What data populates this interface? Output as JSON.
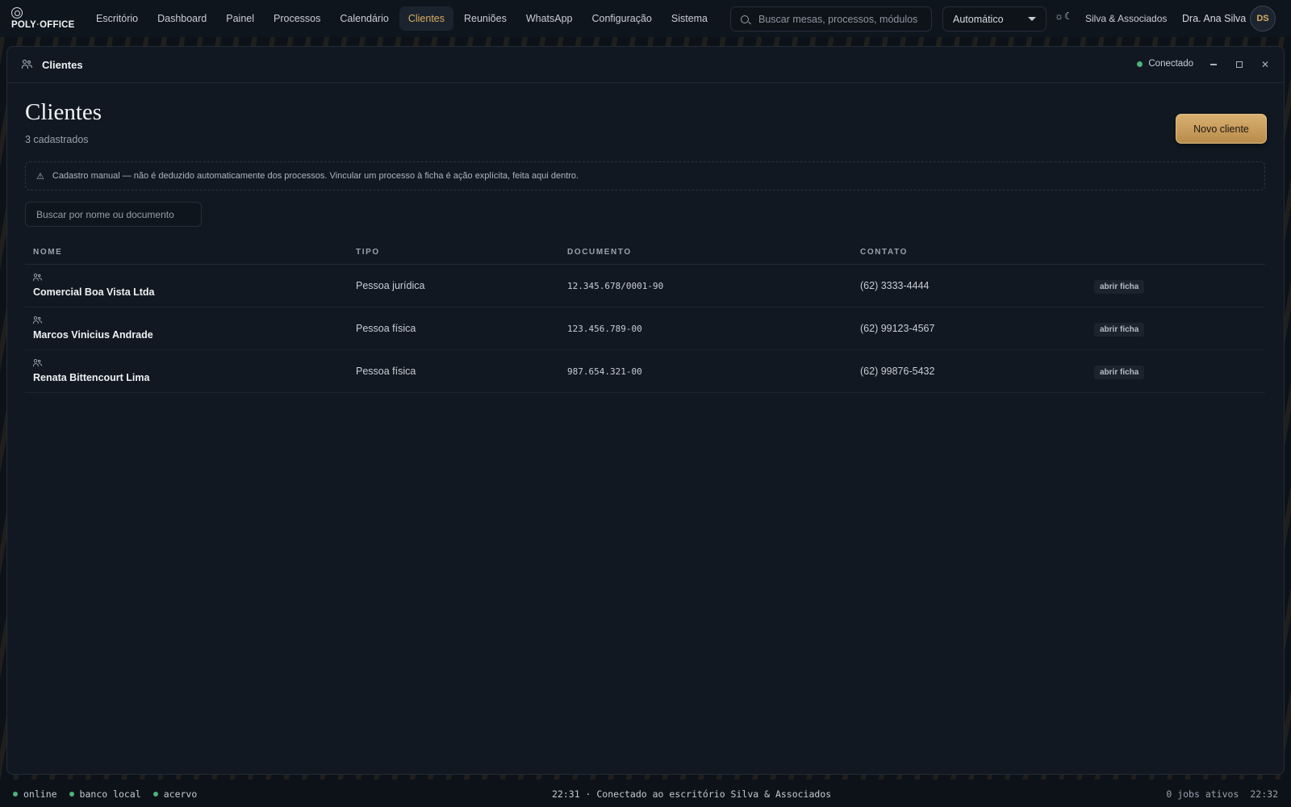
{
  "brand": {
    "name_main": "POLY",
    "name_sep": "·",
    "name_rest": "OFFICE"
  },
  "nav": {
    "items": [
      {
        "label": "Escritório"
      },
      {
        "label": "Dashboard"
      },
      {
        "label": "Painel"
      },
      {
        "label": "Processos"
      },
      {
        "label": "Calendário"
      },
      {
        "label": "Clientes"
      },
      {
        "label": "Reuniões"
      },
      {
        "label": "WhatsApp"
      },
      {
        "label": "Configuração"
      },
      {
        "label": "Sistema"
      }
    ],
    "active": "Clientes"
  },
  "header": {
    "search_placeholder": "Buscar mesas, processos, módulos",
    "mode_value": "Automático",
    "theme_toggle": "☼☾",
    "firm_name": "Silva & Associados",
    "user_name": "Dra. Ana Silva",
    "user_initials": "DS"
  },
  "window": {
    "title": "Clientes",
    "status": "Conectado",
    "status_color": "#4fb27a"
  },
  "page": {
    "title": "Clientes",
    "subtitle": "3 cadastrados",
    "new_button": "Novo cliente",
    "notice": "Cadastro manual — não é deduzido automaticamente dos processos. Vincular um processo à ficha é ação explícita, feita aqui dentro.",
    "search_placeholder": "Buscar por nome ou documento"
  },
  "table": {
    "headers": [
      "NOME",
      "TIPO",
      "DOCUMENTO",
      "CONTATO"
    ],
    "action_label": "abrir ficha",
    "rows": [
      {
        "name": "Comercial Boa Vista Ltda",
        "type": "Pessoa jurídica",
        "document": "12.345.678/0001-90",
        "contact": "(62) 3333-4444"
      },
      {
        "name": "Marcos Vinicius Andrade",
        "type": "Pessoa física",
        "document": "123.456.789-00",
        "contact": "(62) 99123-4567"
      },
      {
        "name": "Renata Bittencourt Lima",
        "type": "Pessoa física",
        "document": "987.654.321-00",
        "contact": "(62) 99876-5432"
      }
    ]
  },
  "statusbar": {
    "indicators": [
      "online",
      "banco local",
      "acervo"
    ],
    "message": "22:31 · Conectado ao escritório Silva & Associados",
    "jobs": "0 jobs ativos",
    "clock": "22:32"
  },
  "colors": {
    "accent": "#d7ae62",
    "background": "#0d1219",
    "window": "#111821"
  }
}
